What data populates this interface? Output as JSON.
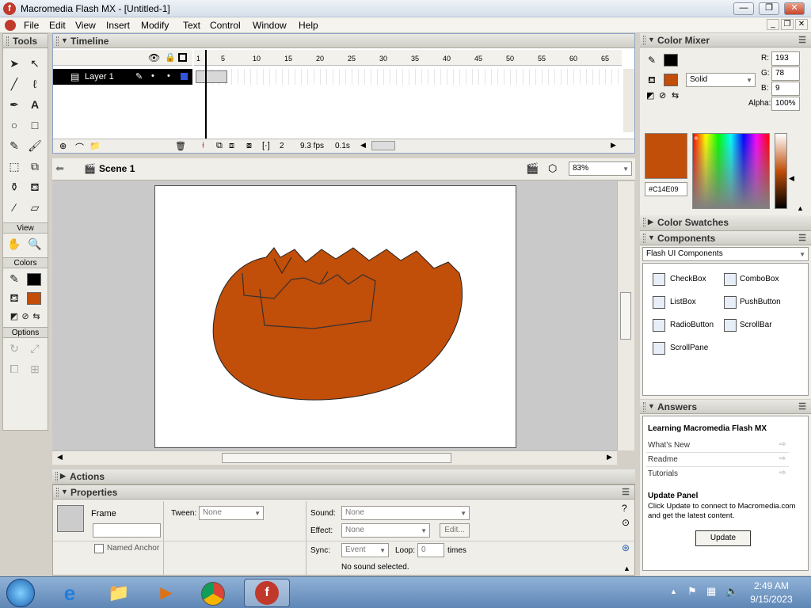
{
  "window": {
    "title": "Macromedia Flash MX - [Untitled-1]",
    "app_glyph": "f",
    "min": "—",
    "max": "❐",
    "close": "✕"
  },
  "menu": [
    "File",
    "Edit",
    "View",
    "Insert",
    "Modify",
    "Text",
    "Control",
    "Window",
    "Help"
  ],
  "mdi": {
    "min": "_",
    "restore": "❐",
    "close": "✕"
  },
  "tools": {
    "title": "Tools",
    "view_label": "View",
    "colors_label": "Colors",
    "options_label": "Options"
  },
  "timeline": {
    "title": "Timeline",
    "layer_name": "Layer 1",
    "ruler": [
      "1",
      "5",
      "10",
      "15",
      "20",
      "25",
      "30",
      "35",
      "40",
      "45",
      "50",
      "55",
      "60",
      "65"
    ],
    "current_frame": "2",
    "fps": "9.3 fps",
    "time": "0.1s"
  },
  "stage": {
    "scene": "Scene 1",
    "zoom": "83%"
  },
  "panels": {
    "actions": "Actions",
    "properties": "Properties"
  },
  "properties": {
    "type": "Frame",
    "tween_label": "Tween:",
    "tween_value": "None",
    "named_anchor": "Named Anchor",
    "sound_label": "Sound:",
    "sound_value": "None",
    "effect_label": "Effect:",
    "effect_value": "None",
    "edit_button": "Edit...",
    "sync_label": "Sync:",
    "sync_value": "Event",
    "loop_label": "Loop:",
    "loop_value": "0",
    "times_label": "times",
    "status": "No sound selected."
  },
  "color_mixer": {
    "title": "Color Mixer",
    "r_label": "R:",
    "r": "193",
    "g_label": "G:",
    "g": "78",
    "b_label": "B:",
    "b": "9",
    "alpha_label": "Alpha:",
    "alpha": "100%",
    "fill_type": "Solid",
    "hex": "#C14E09",
    "fill_color": "#C14E09"
  },
  "swatches": {
    "title": "Color Swatches"
  },
  "components": {
    "title": "Components",
    "set": "Flash UI Components",
    "items": [
      "CheckBox",
      "ComboBox",
      "ListBox",
      "PushButton",
      "RadioButton",
      "ScrollBar",
      "ScrollPane"
    ]
  },
  "answers": {
    "title": "Answers",
    "heading": "Learning Macromedia Flash MX",
    "links": [
      "What's New",
      "Readme",
      "Tutorials"
    ],
    "update_title": "Update Panel",
    "update_text": "Click Update to connect to Macromedia.com and get the latest content.",
    "update_button": "Update"
  },
  "taskbar": {
    "time": "2:49 AM",
    "date": "9/15/2023",
    "tray_expand": "▲"
  }
}
